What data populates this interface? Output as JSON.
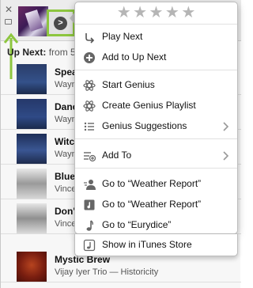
{
  "rating": {
    "stars": [
      "★",
      "★",
      "★",
      "★",
      "★"
    ]
  },
  "up_next": {
    "label": "Up Next:",
    "from_text": "from 5"
  },
  "current_track": {
    "close_glyph": "✕",
    "detail_glyph": ">"
  },
  "tracks": [
    {
      "title": "Speak",
      "artist": "Wayn"
    },
    {
      "title": "Danc",
      "artist": "Wayn"
    },
    {
      "title": "Witch",
      "artist": "Wayn"
    },
    {
      "title": "Bluep",
      "artist": "Vince"
    },
    {
      "title": "Don'",
      "artist": "Vince"
    },
    {
      "title": "Mystic Brew",
      "artist": "Vijay Iyer Trio — Historicity"
    }
  ],
  "menu": {
    "items": [
      {
        "label": "Play Next",
        "icon": "play-next-icon"
      },
      {
        "label": "Add to Up Next",
        "icon": "add-circle-icon"
      },
      {
        "label": "Start Genius",
        "icon": "genius-atom-icon"
      },
      {
        "label": "Create Genius Playlist",
        "icon": "genius-atom-icon"
      },
      {
        "label": "Genius Suggestions",
        "icon": "list-icon",
        "submenu": true
      },
      {
        "label": "Add To",
        "icon": "add-to-list-icon",
        "submenu": true
      },
      {
        "label": "Go to “Weather Report”",
        "icon": "artist-icon"
      },
      {
        "label": "Go to “Weather Report”",
        "icon": "album-icon"
      },
      {
        "label": "Go to “Eurydice”",
        "icon": "song-note-icon"
      },
      {
        "label": "Show in iTunes Store",
        "icon": "store-icon"
      }
    ]
  },
  "colors": {
    "callout": "#8dc63f",
    "star": "#b5b5b5",
    "menu_text": "#111111"
  }
}
